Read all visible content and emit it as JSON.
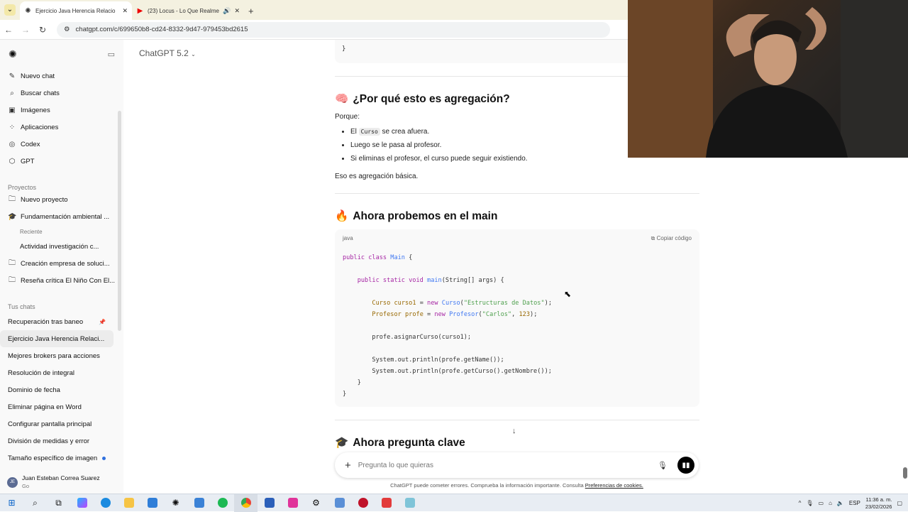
{
  "browser": {
    "tabs": [
      {
        "title": "Ejercicio Java Herencia Relacio",
        "active": true
      },
      {
        "title": "(23) Locus - Lo Que Realme",
        "active": false
      }
    ],
    "url": "chatgpt.com/c/699650b8-cd24-8332-9d47-979453bd2615"
  },
  "sidebar": {
    "nav": [
      {
        "label": "Nuevo chat",
        "icon": "pencil-icon"
      },
      {
        "label": "Buscar chats",
        "icon": "search-icon"
      },
      {
        "label": "Imágenes",
        "icon": "image-icon"
      },
      {
        "label": "Aplicaciones",
        "icon": "apps-icon"
      },
      {
        "label": "Codex",
        "icon": "codex-icon"
      },
      {
        "label": "GPT",
        "icon": "gpt-icon"
      }
    ],
    "projects_heading": "Proyectos",
    "projects": [
      {
        "label": "Nuevo proyecto"
      },
      {
        "label": "Fundamentación ambiental ..."
      }
    ],
    "recent_heading": "Reciente",
    "recent_item": "Actividad investigación c...",
    "projects_more": [
      {
        "label": "Creación empresa de soluci..."
      },
      {
        "label": "Reseña crítica El Niño Con El..."
      }
    ],
    "chats_heading": "Tus chats",
    "chats": [
      {
        "label": "Recuperación tras baneo"
      },
      {
        "label": "Ejercicio Java Herencia Relaci..."
      },
      {
        "label": "Mejores brokers para acciones"
      },
      {
        "label": "Resolución de integral"
      },
      {
        "label": "Dominio de fecha"
      },
      {
        "label": "Eliminar página en Word"
      },
      {
        "label": "Configurar pantalla principal"
      },
      {
        "label": "División de medidas y error"
      },
      {
        "label": "Tamaño específico de imagen"
      }
    ],
    "user": {
      "name": "Juan Esteban Correa Suarez",
      "plan": "Go",
      "initials": "JE"
    }
  },
  "header": {
    "model": "ChatGPT 5.2"
  },
  "content": {
    "top_code_fragment": "}",
    "section1": {
      "title": "¿Por qué esto es agregación?",
      "lead": "Porque:",
      "bullets": [
        {
          "before": "El ",
          "code": "Curso",
          "after": " se crea afuera."
        },
        {
          "before": "Luego se le pasa al profesor.",
          "code": "",
          "after": ""
        },
        {
          "before": "Si eliminas el profesor, el curso puede seguir existiendo.",
          "code": "",
          "after": ""
        }
      ],
      "conclusion": "Eso es agregación básica."
    },
    "section2": {
      "title": "Ahora probemos en el main",
      "code_lang": "java",
      "copy_label": "Copiar código"
    },
    "section3": {
      "title": "Ahora pregunta clave"
    }
  },
  "composer": {
    "placeholder": "Pregunta lo que quieras"
  },
  "disclaimer": {
    "text": "ChatGPT puede cometer errores. Comprueba la información importante. Consulta",
    "link": "Preferencias de cookies."
  },
  "taskbar": {
    "lang": "ESP",
    "time": "11:36 a. m.",
    "date": "23/02/2026"
  }
}
